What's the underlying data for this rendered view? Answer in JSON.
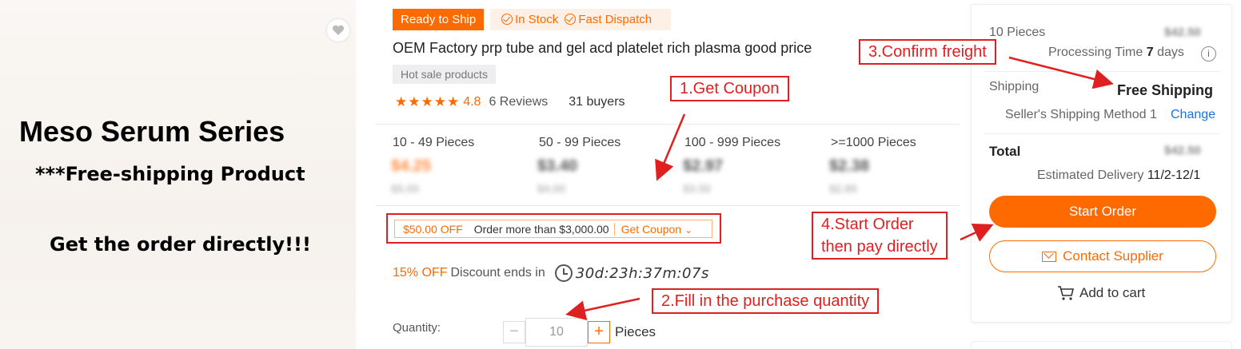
{
  "promo": {
    "title": "Meso Serum Series",
    "subtitle": "***Free-shipping Product",
    "cta": "Get the order directly!!!"
  },
  "badges": {
    "ready": "Ready to Ship",
    "in_stock": "In Stock",
    "fast": "Fast Dispatch"
  },
  "product": {
    "title": "OEM Factory prp tube and gel acd platelet rich plasma good price",
    "tag": "Hot sale products",
    "stars": "★★★★★",
    "rating": "4.8",
    "reviews": "6 Reviews",
    "buyers": "31 buyers"
  },
  "tiers": [
    {
      "qty": "10 - 49 Pieces",
      "price": "$4.25",
      "orig": "$5.00"
    },
    {
      "qty": "50 - 99 Pieces",
      "price": "$3.40",
      "orig": "$4.00"
    },
    {
      "qty": "100 - 999 Pieces",
      "price": "$2.97",
      "orig": "$3.50"
    },
    {
      "qty": ">=1000 Pieces",
      "price": "$2.38",
      "orig": "$2.80"
    }
  ],
  "coupon": {
    "off": "$50.00 OFF",
    "condition": "Order more than $3,000.00",
    "get": "Get Coupon",
    "chevron": "⌄"
  },
  "discount": {
    "pct": "15% OFF",
    "label": "Discount ends in",
    "timer": "30d:23h:37m:07s"
  },
  "quantity": {
    "label": "Quantity:",
    "minus": "−",
    "value": "10",
    "plus": "+",
    "unit": "Pieces"
  },
  "order": {
    "pieces": "10 Pieces",
    "pieces_price": "$42.50",
    "processing_label": "Processing Time",
    "processing_days": "7",
    "processing_unit": "days",
    "info": "i",
    "shipping_label": "Shipping",
    "shipping_value": "Free Shipping",
    "method": "Seller's Shipping Method 1",
    "change": "Change",
    "total_label": "Total",
    "total_value": "$42.50",
    "delivery_label": "Estimated Delivery",
    "delivery_value": "11/2-12/1",
    "start": "Start Order",
    "contact": "Contact Supplier",
    "cart": "Add to cart"
  },
  "annotations": {
    "coupon": "1.Get Coupon",
    "quantity": "2.Fill in the purchase quantity",
    "freight": "3.Confirm freight",
    "start_line1": "4.Start Order",
    "start_line2": "then pay directly"
  },
  "colors": {
    "accent": "#ff6a00",
    "annotation": "#e02020",
    "link": "#1a73e8"
  }
}
